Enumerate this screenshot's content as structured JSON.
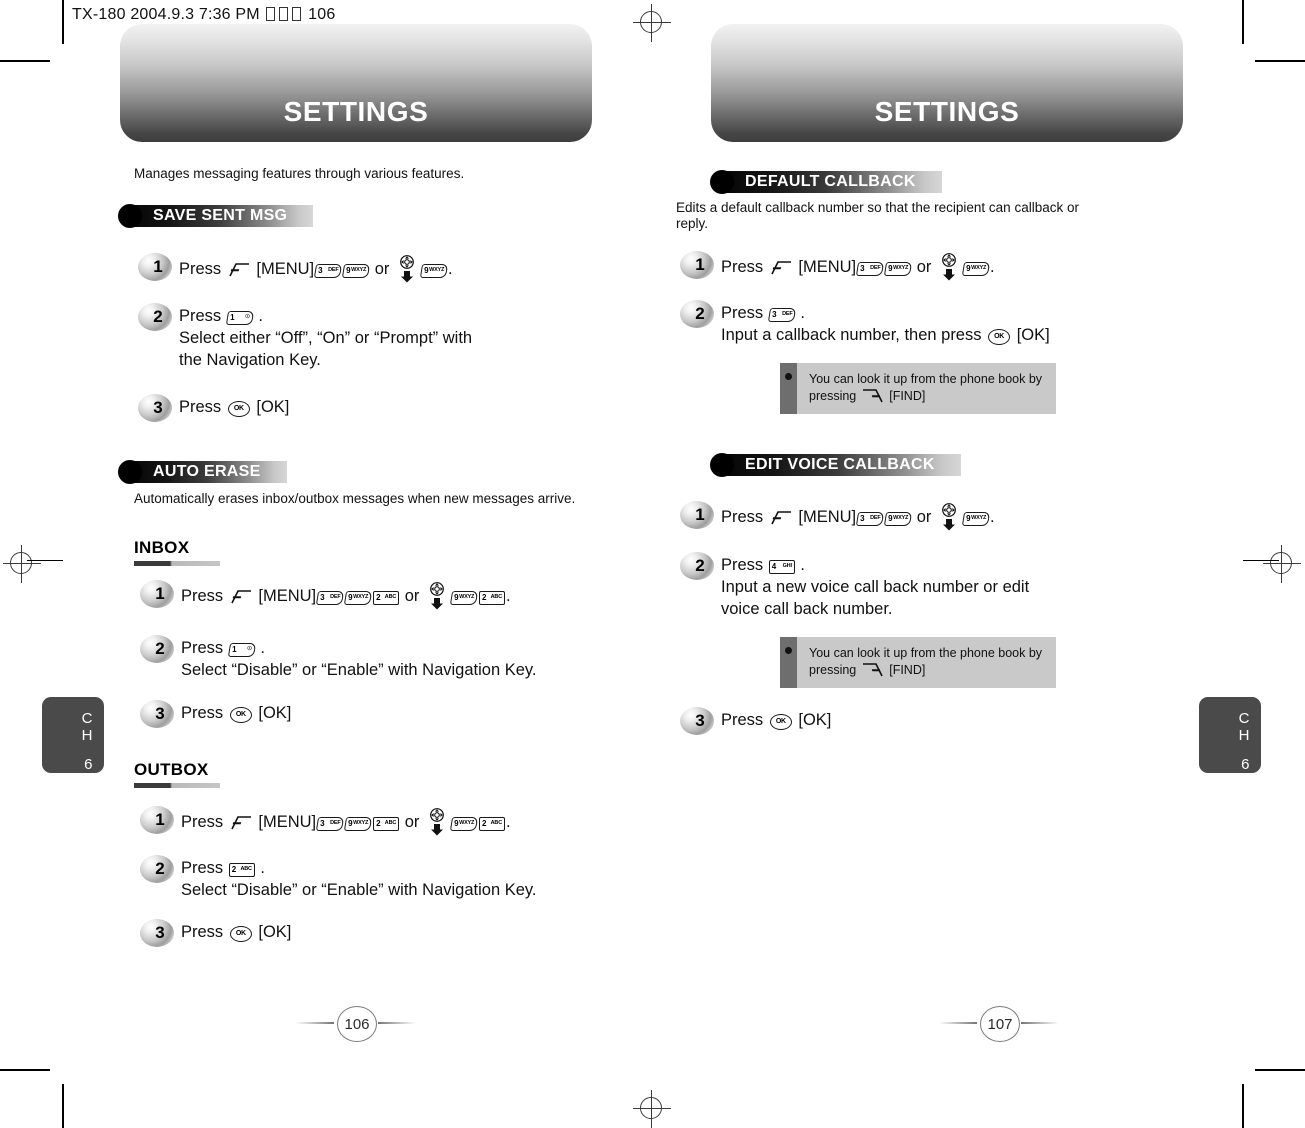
{
  "scan_header": {
    "model": "TX-180",
    "date": "2004.9.3",
    "time": "7:36 PM",
    "page_marker": "106",
    "full": "TX-180  2004.9.3 7:36 PM"
  },
  "chapter_tab": {
    "ch": "C",
    "h": "H",
    "number": "6"
  },
  "left_page": {
    "banner_title": "SETTINGS",
    "page_number": "106",
    "intro": "Manages messaging features through various features.",
    "sections": [
      {
        "badge": "SAVE SENT MSG",
        "steps": [
          {
            "n": "1",
            "lines": [
              "Press [MENU] 3 9 or NAV 9."
            ]
          },
          {
            "n": "2",
            "lines": [
              "Press 1 .",
              "Select either “Off”, “On” or “Prompt” with",
              "the Navigation Key."
            ]
          },
          {
            "n": "3",
            "lines": [
              "Press OK [OK]."
            ]
          }
        ]
      },
      {
        "badge": "AUTO ERASE",
        "description": "Automatically erases inbox/outbox messages when new messages arrive.",
        "subsections": [
          {
            "title": "INBOX",
            "steps": [
              {
                "n": "1",
                "lines": [
                  "Press [MENU] 3 9 2 or NAV 9 2."
                ]
              },
              {
                "n": "2",
                "lines": [
                  "Press 1 .",
                  "Select “Disable” or “Enable” with Navigation Key."
                ]
              },
              {
                "n": "3",
                "lines": [
                  "Press OK [OK]."
                ]
              }
            ]
          },
          {
            "title": "OUTBOX",
            "steps": [
              {
                "n": "1",
                "lines": [
                  "Press [MENU] 3 9 2 or NAV 9 2."
                ]
              },
              {
                "n": "2",
                "lines": [
                  "Press 2 .",
                  "Select “Disable” or “Enable” with Navigation Key."
                ]
              },
              {
                "n": "3",
                "lines": [
                  "Press OK [OK]."
                ]
              }
            ]
          }
        ]
      }
    ]
  },
  "right_page": {
    "banner_title": "SETTINGS",
    "page_number": "107",
    "sections": [
      {
        "badge": "DEFAULT CALLBACK",
        "description_lines": [
          "Edits a default callback number so that the recipient can callback or",
          "reply."
        ],
        "steps": [
          {
            "n": "1",
            "lines": [
              "Press [MENU] 3 9 or NAV 9."
            ]
          },
          {
            "n": "2",
            "lines": [
              "Press 3 .",
              "Input a callback number, then press OK [OK]."
            ]
          }
        ],
        "note": {
          "lines": [
            "You can look it up from the phone book by",
            "pressing FIND [FIND]."
          ]
        }
      },
      {
        "badge": "EDIT VOICE CALLBACK",
        "steps": [
          {
            "n": "1",
            "lines": [
              "Press [MENU] 3 9 or NAV 9."
            ]
          },
          {
            "n": "2",
            "lines": [
              "Press 4 .",
              "Input a new voice call back number or edit",
              "voice call back number."
            ]
          },
          {
            "n": "3",
            "lines": [
              "Press OK [OK]."
            ]
          }
        ],
        "note": {
          "lines": [
            "You can look it up from the phone book by",
            "pressing FIND [FIND]."
          ]
        }
      }
    ]
  },
  "labels": {
    "press": "Press",
    "menu": "[MENU]",
    "ok": "[OK]",
    "find": "[FIND]",
    "or": "or",
    "period": ".",
    "save_sent_step2_b": "Select either “Off”, “On” or “Prompt” with",
    "save_sent_step2_c": "the Navigation Key.",
    "select_disable_enable": "Select “Disable” or “Enable” with Navigation Key.",
    "input_callback": "Input a callback number, then press",
    "input_voice_a": "Input a new voice call back number or edit",
    "input_voice_b": "voice call back number.",
    "note_line1": "You can look it up from the phone book by",
    "note_pressing": "pressing"
  },
  "keys": {
    "k1": {
      "digit": "1",
      "letters": "☉"
    },
    "k2": {
      "digit": "2",
      "letters": "ABC"
    },
    "k3": {
      "digit": "3",
      "letters": "DEF"
    },
    "k4": {
      "digit": "4",
      "letters": "GHI"
    },
    "k9": {
      "digit": "9",
      "letters": "WXYZ"
    },
    "ok": "OK"
  },
  "colors": {
    "banner_top": "#f2f2f2",
    "banner_bottom": "#3d3d3d",
    "badge_dark": "#050505",
    "badge_light": "#d6d6d6",
    "note_body": "#c9c9c9",
    "note_stripe": "#6e6e6e",
    "tab_bg": "#4a4a4a",
    "text": "#111111"
  }
}
